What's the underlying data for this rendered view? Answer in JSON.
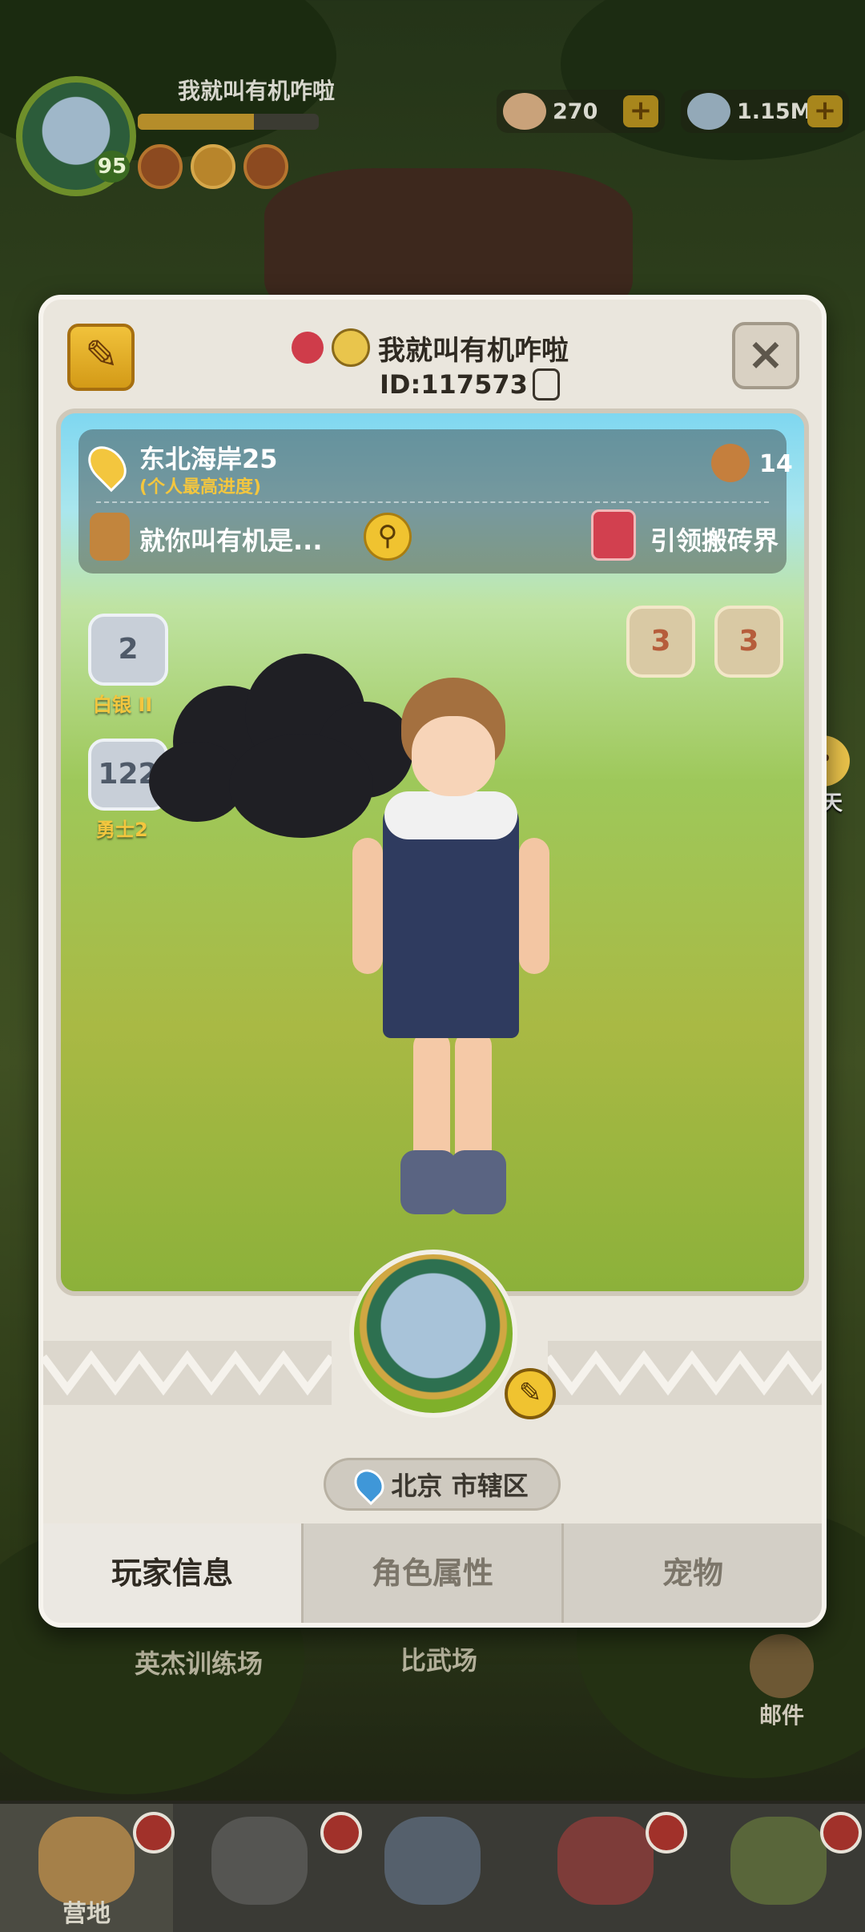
{
  "hud": {
    "player_name": "我就叫有机咋啦",
    "level": "95",
    "xp_fraction": 0.64,
    "currency_1": "270",
    "currency_2": "1.15M",
    "plus_label": "+"
  },
  "background_labels": {
    "training": "英杰训练场",
    "arena": "比武场"
  },
  "side": {
    "chat_label": "聊天",
    "mail_label": "邮件"
  },
  "modal": {
    "player_name": "我就叫有机咋啦",
    "id_text": "ID:117573",
    "close_label": "×",
    "location_title": "东北海岸25",
    "location_sub": "(个人最高进度)",
    "friends_count": "14",
    "guild_name": "就你叫有机是...",
    "title_label": "引领搬砖界",
    "rank_1_num": "2",
    "rank_1_label": "白银 II",
    "rank_2_num": "122",
    "rank_2_label": "勇士2",
    "medal_1": "3",
    "medal_2": "3",
    "city": "北京 市辖区",
    "tabs": [
      "玩家信息",
      "角色属性",
      "宠物"
    ]
  },
  "bottom_nav": [
    {
      "label": "营地",
      "active": true
    },
    {
      "label": "",
      "active": false
    },
    {
      "label": "",
      "active": false
    },
    {
      "label": "",
      "active": false
    },
    {
      "label": "",
      "active": false
    }
  ],
  "colors": {
    "accent_gold": "#f0c330",
    "badge_red": "#a1312a",
    "panel_bg": "#eae6dd"
  }
}
